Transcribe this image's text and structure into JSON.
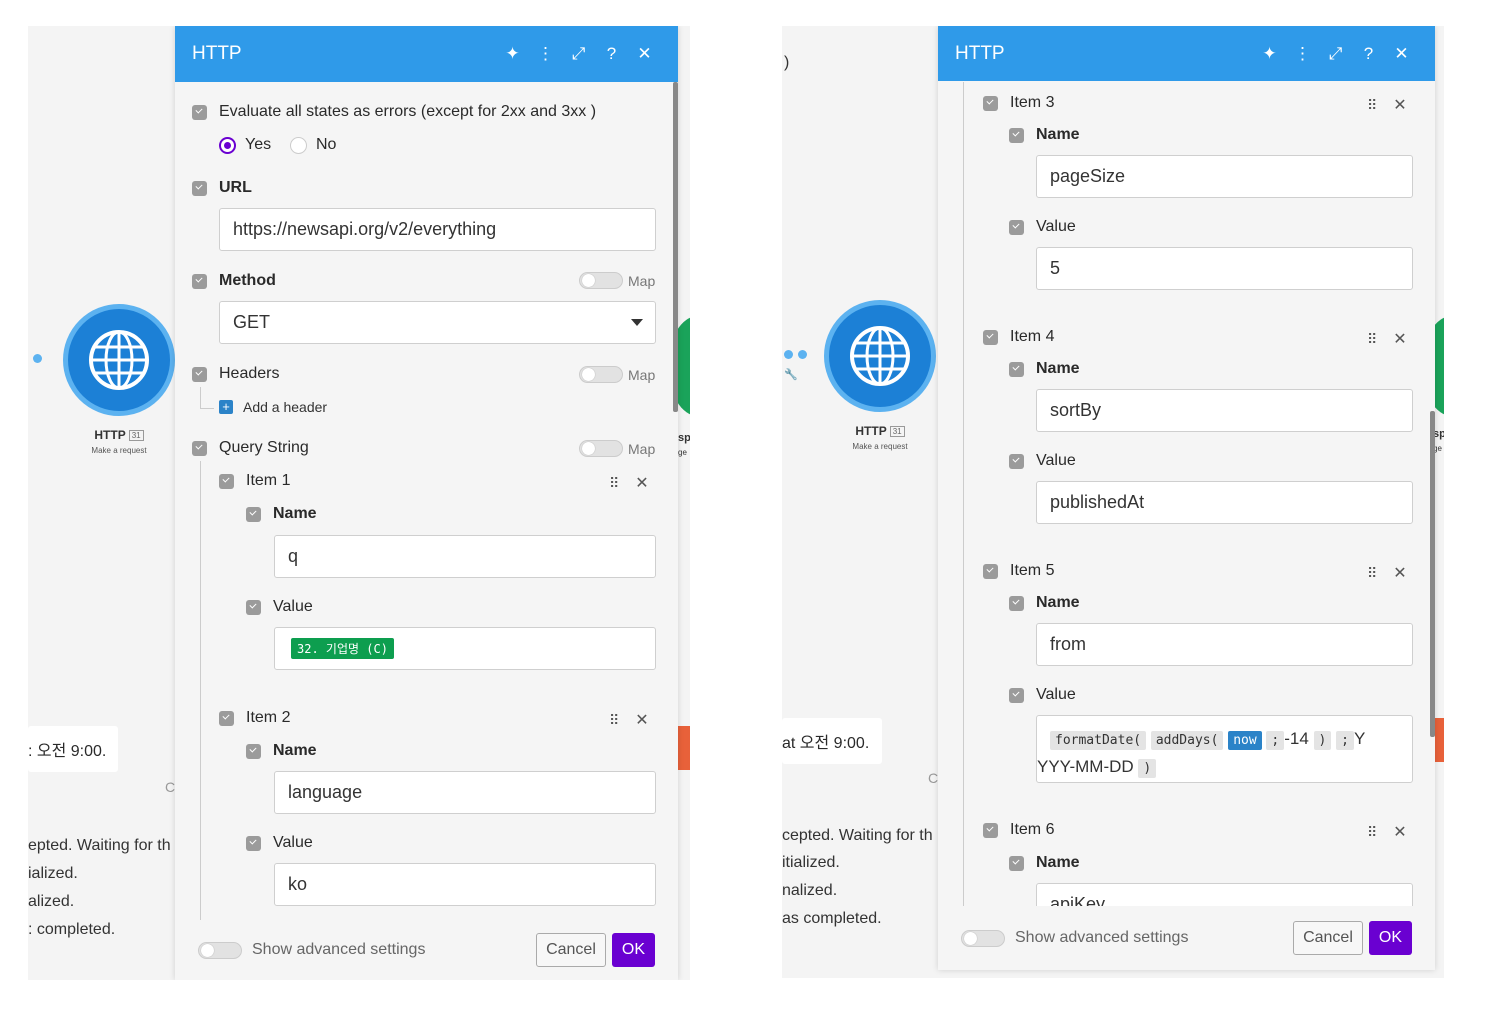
{
  "left": {
    "panel_title": "HTTP",
    "evaluate_label": "Evaluate all states as errors (except for 2xx and 3xx )",
    "yes_label": "Yes",
    "no_label": "No",
    "url_label": "URL",
    "url_value": "https://newsapi.org/v2/everything",
    "method_label": "Method",
    "method_value": "GET",
    "headers_label": "Headers",
    "add_header_label": "Add a header",
    "query_label": "Query String",
    "map_label": "Map",
    "item1_label": "Item 1",
    "item1_name_label": "Name",
    "item1_name_value": "q",
    "item1_value_label": "Value",
    "item1_value_pill": "32. 기업명 (C)",
    "item2_label": "Item 2",
    "item2_name_label": "Name",
    "item2_name_value": "language",
    "item2_value_label": "Value",
    "item2_value_value": "ko",
    "advanced_label": "Show advanced settings",
    "cancel_label": "Cancel",
    "ok_label": "OK",
    "node_label": "HTTP",
    "node_badge": "31",
    "node_sub": "Make a request",
    "bg_time": ": 오전 9:00.",
    "bg_c": "C",
    "bg_sp": "sp",
    "bg_ge": "ge",
    "bg_lines": [
      "epted. Waiting for th",
      "ialized.",
      "alized.",
      ": completed."
    ]
  },
  "right": {
    "panel_title": "HTTP",
    "item3_label": "Item 3",
    "item3_name_label": "Name",
    "item3_name_value": "pageSize",
    "item3_value_label": "Value",
    "item3_value_value": "5",
    "item4_label": "Item 4",
    "item4_name_label": "Name",
    "item4_name_value": "sortBy",
    "item4_value_label": "Value",
    "item4_value_value": "publishedAt",
    "item5_label": "Item 5",
    "item5_name_label": "Name",
    "item5_name_value": "from",
    "item5_value_label": "Value",
    "fn_formatdate": "formatDate(",
    "fn_adddays": "addDays(",
    "fn_now": "now",
    "fn_sep1": ";",
    "fn_num": "-14",
    "fn_close1": ")",
    "fn_sep2": ";",
    "fn_y": "Y",
    "fn_format": "YYY-MM-DD",
    "fn_close2": ")",
    "item6_label": "Item 6",
    "item6_name_label": "Name",
    "item6_name_value": "apiKey",
    "advanced_label": "Show advanced settings",
    "cancel_label": "Cancel",
    "ok_label": "OK",
    "node_label": "HTTP",
    "node_badge": "31",
    "node_sub": "Make a request",
    "bg_paren": ")",
    "bg_time": "at 오전 9:00.",
    "bg_c": "C",
    "bg_sp": "sp",
    "bg_ge": "ge",
    "bg_lines": [
      "cepted. Waiting for th",
      "itialized.",
      "nalized.",
      "as completed."
    ]
  },
  "icons": [
    "sparkle-icon",
    "more-vertical-icon",
    "expand-icon",
    "help-icon",
    "close-icon",
    "globe-icon",
    "drag-grip-icon",
    "remove-icon",
    "plus-icon",
    "wrench-icon"
  ],
  "colors": {
    "header": "#2f9ae9",
    "ok_button": "#6a00d1",
    "node": "#1c80d6",
    "pill_green": "#0d9e4f",
    "fn_blue": "#2b83c8"
  }
}
